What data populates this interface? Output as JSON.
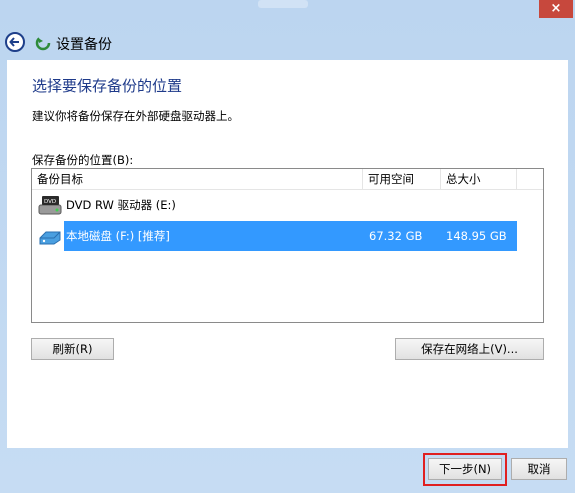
{
  "window": {
    "close_glyph": "×"
  },
  "header": {
    "title": "设置备份",
    "back_icon": "back-arrow-icon",
    "app_icon": "backup-icon"
  },
  "main": {
    "heading": "选择要保存备份的位置",
    "subtitle": "建议你将备份保存在外部硬盘驱动器上。",
    "location_label": "保存备份的位置(B):",
    "columns": [
      "备份目标",
      "可用空间",
      "总大小"
    ],
    "rows": [
      {
        "name": "DVD RW 驱动器 (E:)",
        "free": "",
        "total": "",
        "icon": "dvd-drive-icon",
        "selected": false
      },
      {
        "name": "本地磁盘 (F:) [推荐]",
        "free": "67.32 GB",
        "total": "148.95 GB",
        "icon": "hard-disk-icon",
        "selected": true
      }
    ],
    "refresh_label": "刷新(R)",
    "save_network_label": "保存在网络上(V)..."
  },
  "footer": {
    "next_label": "下一步(N)",
    "cancel_label": "取消"
  },
  "colors": {
    "selection": "#3399ff",
    "heading": "#1e3a8a",
    "highlight": "#e02020"
  }
}
